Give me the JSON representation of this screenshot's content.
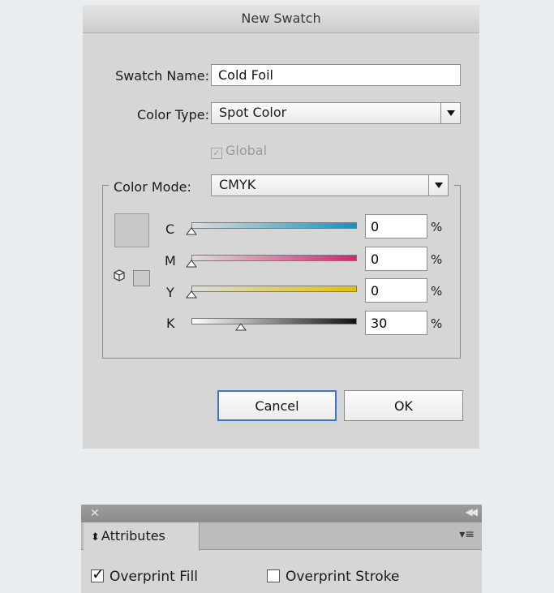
{
  "dialog": {
    "title": "New Swatch",
    "swatch_name_label": "Swatch Name:",
    "swatch_name_value": "Cold Foil",
    "color_type_label": "Color Type:",
    "color_type_value": "Spot Color",
    "global_label": "Global",
    "color_mode_label": "Color Mode:",
    "color_mode_value": "CMYK",
    "channels": [
      {
        "label": "C",
        "value": "0",
        "fraction": 0.0,
        "ramp_end": "#1592c4"
      },
      {
        "label": "M",
        "value": "0",
        "fraction": 0.0,
        "ramp_end": "#d2266e"
      },
      {
        "label": "Y",
        "value": "0",
        "fraction": 0.0,
        "ramp_end": "#e3c200"
      },
      {
        "label": "K",
        "value": "30",
        "fraction": 0.3,
        "ramp_end": "#111111"
      }
    ],
    "percent_sign": "%",
    "swatch_preview_color": "#c8c8c8",
    "cancel_label": "Cancel",
    "ok_label": "OK"
  },
  "attributes_panel": {
    "tab_label": "Attributes",
    "overprint_fill_label": "Overprint Fill",
    "overprint_fill_checked": true,
    "overprint_stroke_label": "Overprint Stroke",
    "overprint_stroke_checked": false
  }
}
